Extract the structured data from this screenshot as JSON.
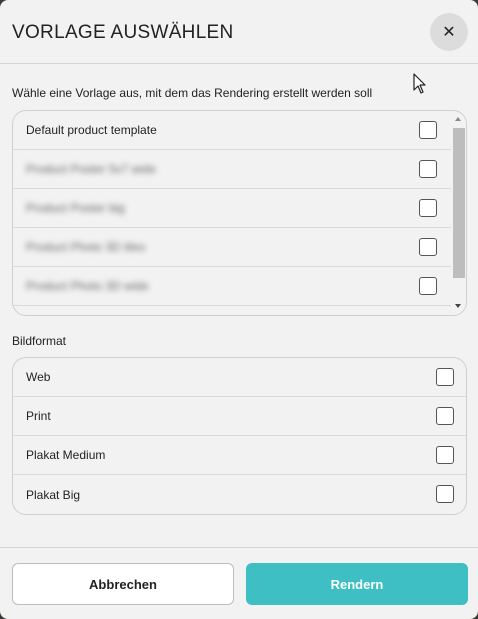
{
  "dialog": {
    "title": "VORLAGE AUSWÄHLEN",
    "close_glyph": "✕",
    "subtitle": "Wähle eine Vorlage aus, mit dem das Rendering erstellt werden soll"
  },
  "templates": {
    "items": [
      {
        "label": "Default product template",
        "checked": false,
        "blurred": false
      },
      {
        "label": "Product Poster 5x7 wide",
        "checked": false,
        "blurred": true
      },
      {
        "label": "Product Poster big",
        "checked": false,
        "blurred": true
      },
      {
        "label": "Product Photo 3D tiles",
        "checked": false,
        "blurred": true
      },
      {
        "label": "Product Photo 3D wide",
        "checked": false,
        "blurred": true
      }
    ]
  },
  "formats": {
    "label": "Bildformat",
    "items": [
      {
        "label": "Web",
        "checked": false
      },
      {
        "label": "Print",
        "checked": false
      },
      {
        "label": "Plakat Medium",
        "checked": false
      },
      {
        "label": "Plakat Big",
        "checked": false
      }
    ]
  },
  "footer": {
    "cancel_label": "Abbrechen",
    "render_label": "Rendern"
  },
  "colors": {
    "accent": "#3dbfc4",
    "background": "#f2f2f2"
  }
}
